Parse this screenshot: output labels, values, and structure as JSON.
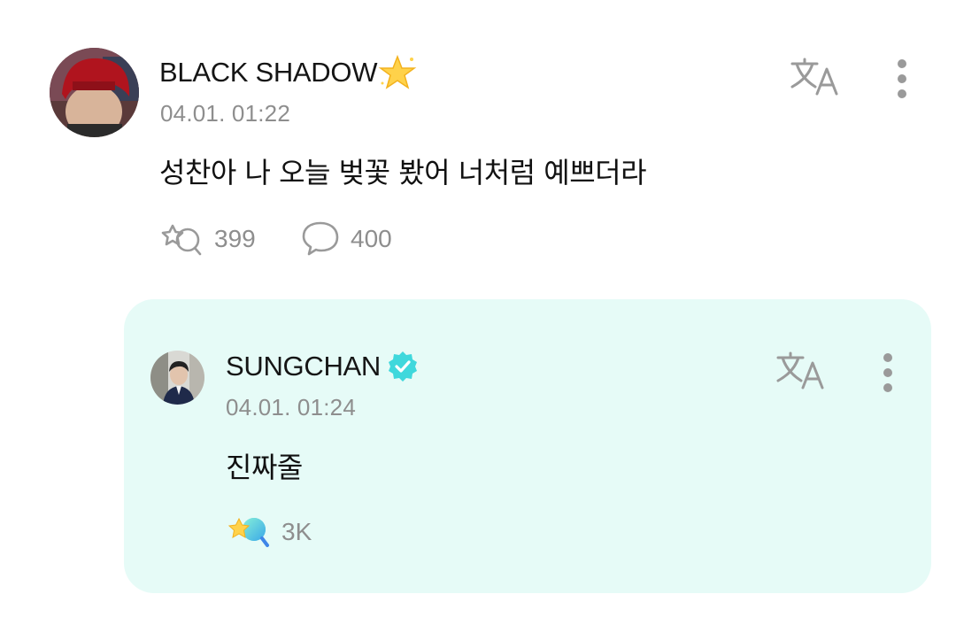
{
  "post": {
    "author": "BLACK SHADOW",
    "author_emoji": "🌟",
    "timestamp": "04.01. 01:22",
    "text": "성찬아 나 오늘 벚꽃 봤어 너처럼 예쁘더라",
    "reaction_count": "399",
    "comment_count": "400",
    "icons": [
      "translate-icon",
      "more-vertical-icon",
      "reaction-outline-icon",
      "comment-bubble-icon"
    ]
  },
  "reply": {
    "author": "SUNGCHAN",
    "verified": true,
    "timestamp": "04.01. 01:24",
    "text": "진짜줄",
    "reaction_count": "3K",
    "icons": [
      "translate-icon",
      "more-vertical-icon",
      "reaction-filled-icon",
      "verified-badge-icon"
    ]
  },
  "colors": {
    "reply_background": "#e6fbf7",
    "verified_badge": "#3fd8dc",
    "icon_gray": "#9a9a9a",
    "meta_gray": "#8e8e8e"
  }
}
